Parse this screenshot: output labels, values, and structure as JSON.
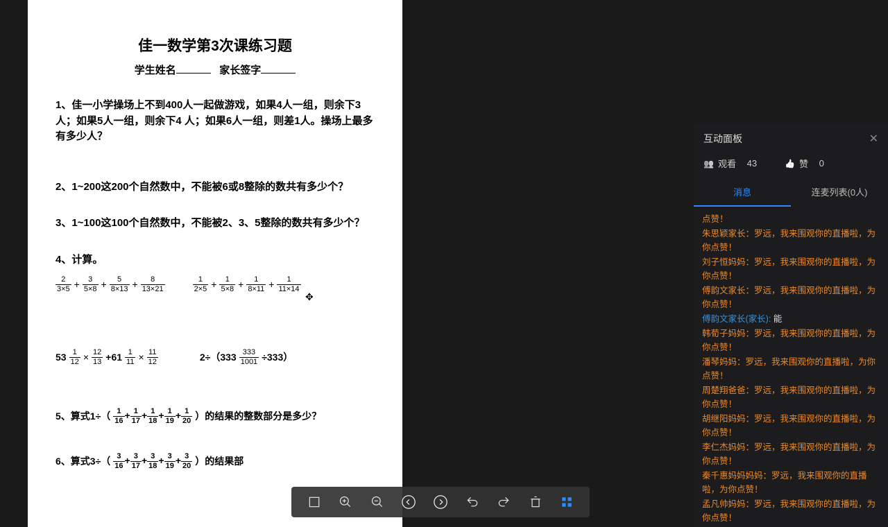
{
  "document": {
    "title": "佳一数学第3次课练习题",
    "subtitle_student": "学生姓名",
    "subtitle_parent": "家长签字",
    "q1": "1、佳一小学操场上不到400人一起做游戏，如果4人一组，则余下3人；如果5人一组，则余下4 人；如果6人一组，则差1人。操场上最多有多少人？",
    "q2": "2、1~200这200个自然数中，不能被6或8整除的数共有多少个？",
    "q3": "3、1~100这100个自然数中，不能被2、3、5整除的数共有多少个？",
    "q4": "4、计算。",
    "q5": "5、算式1÷（",
    "q5_tail": "）的结果的整数部分是多少？",
    "q6": "6、算式3÷（",
    "q6_tail": "）的结果部",
    "expr_a_nums": [
      "2",
      "3",
      "5",
      "8"
    ],
    "expr_a_dens": [
      "3×5",
      "5×8",
      "8×13",
      "13×21"
    ],
    "expr_b_nums": [
      "1",
      "1",
      "1",
      "1"
    ],
    "expr_b_dens": [
      "2×5",
      "5×8",
      "8×11",
      "11×14"
    ],
    "expr_c_pre": "53",
    "expr_c_num1": "1",
    "expr_c_den1": "12",
    "expr_c_mid1": "×",
    "expr_c_num2": "12",
    "expr_c_den2": "13",
    "expr_c_plus": "+61",
    "expr_c_num3": "1",
    "expr_c_den3": "11",
    "expr_c_mid2": "×",
    "expr_c_num4": "11",
    "expr_c_den4": "12",
    "expr_d_pre": "2÷（333",
    "expr_d_num": "333",
    "expr_d_den": "1001",
    "expr_d_post": "÷333）",
    "q5_nums": [
      "1",
      "1",
      "1",
      "1",
      "1"
    ],
    "q5_dens": [
      "16",
      "17",
      "18",
      "19",
      "20"
    ],
    "q6_nums": [
      "3",
      "3",
      "3",
      "3",
      "3"
    ],
    "q6_dens": [
      "16",
      "17",
      "18",
      "19",
      "20"
    ]
  },
  "panel": {
    "title": "互动面板",
    "watch_label": "观看",
    "watch_count": "43",
    "like_label": "赞",
    "like_count": "0",
    "tab_msg": "消息",
    "tab_mic": "连麦列表(0人)"
  },
  "messages": [
    {
      "text": "点赞！"
    },
    {
      "text": "朱思颖家长：罗远，我来围观你的直播啦，为你点赞！"
    },
    {
      "text": "刘子恒妈妈：罗远，我来围观你的直播啦，为你点赞！"
    },
    {
      "text": "傅韵文家长：罗远，我来围观你的直播啦，为你点赞！"
    },
    {
      "user_blue": "傅韵文家长(家长):",
      "white": " 能"
    },
    {
      "text": "韩荀子妈妈：罗远，我来围观你的直播啦，为你点赞！"
    },
    {
      "text": "潘琴妈妈：罗远，我来围观你的直播啦，为你点赞！"
    },
    {
      "text": "周楚翔爸爸：罗远，我来围观你的直播啦，为你点赞！"
    },
    {
      "text": "胡继阳妈妈：罗远，我来围观你的直播啦，为你点赞！"
    },
    {
      "text": "李仁杰妈妈：罗远，我来围观你的直播啦，为你点赞！"
    },
    {
      "text": "秦千惠妈妈妈妈：罗远，我来围观你的直播啦，为你点赞！"
    },
    {
      "text": "孟凡帅妈妈：罗远，我来围观你的直播啦，为你点赞！"
    }
  ]
}
